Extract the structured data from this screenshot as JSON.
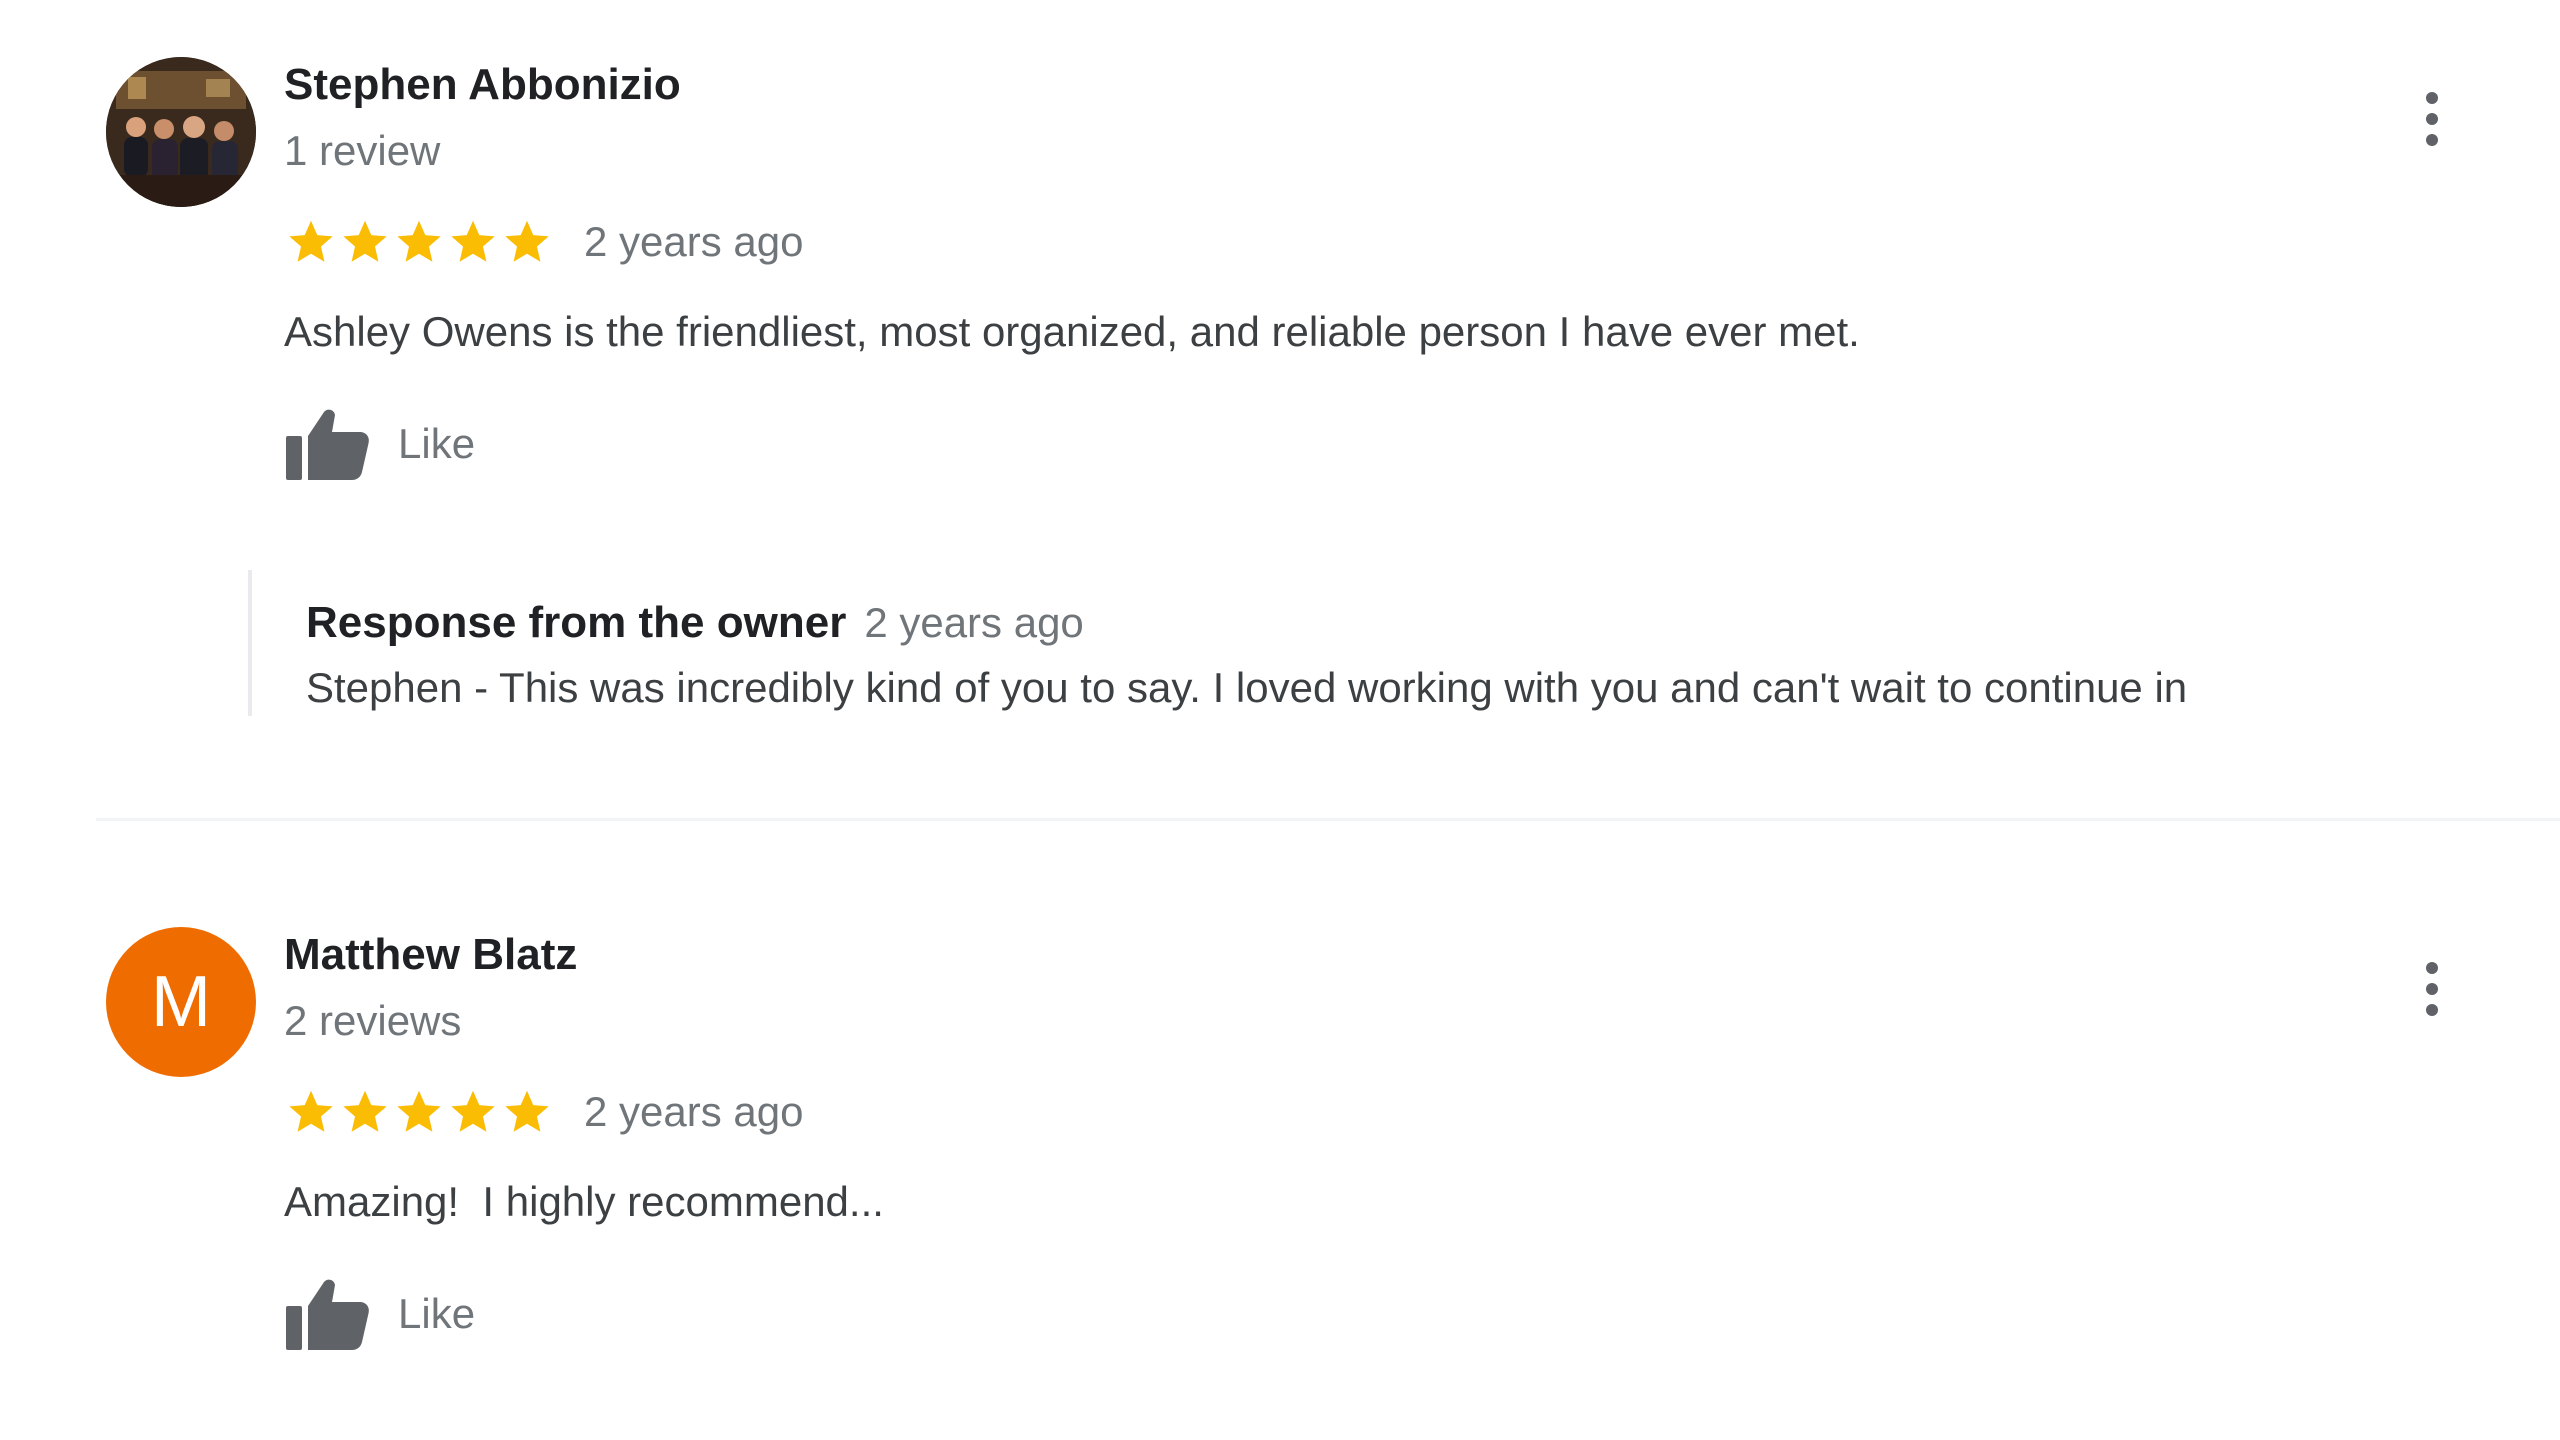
{
  "reviews": [
    {
      "name": "Stephen Abbonizio",
      "review_count": "1 review",
      "rating": 5,
      "date": "2 years ago",
      "text": "Ashley Owens is the friendliest, most organized, and reliable person I have ever met.",
      "like_label": "Like",
      "avatar": {
        "type": "photo"
      },
      "owner_response": {
        "title": "Response from the owner",
        "date": "2 years ago",
        "text": "Stephen - This was incredibly kind of you to say. I loved working with you and can't wait to continue in"
      }
    },
    {
      "name": "Matthew Blatz",
      "review_count": "2 reviews",
      "rating": 5,
      "date": "2 years ago",
      "text": "Amazing!  I highly recommend...",
      "like_label": "Like",
      "avatar": {
        "type": "letter",
        "letter": "M",
        "color": "#ef6c00"
      }
    }
  ],
  "colors": {
    "star": "#fbbc04",
    "secondary_text": "#70757a",
    "icon": "#5f6368"
  },
  "icons": {
    "star": "star-icon",
    "like": "thumbs-up-icon",
    "more": "more-vert-icon"
  }
}
